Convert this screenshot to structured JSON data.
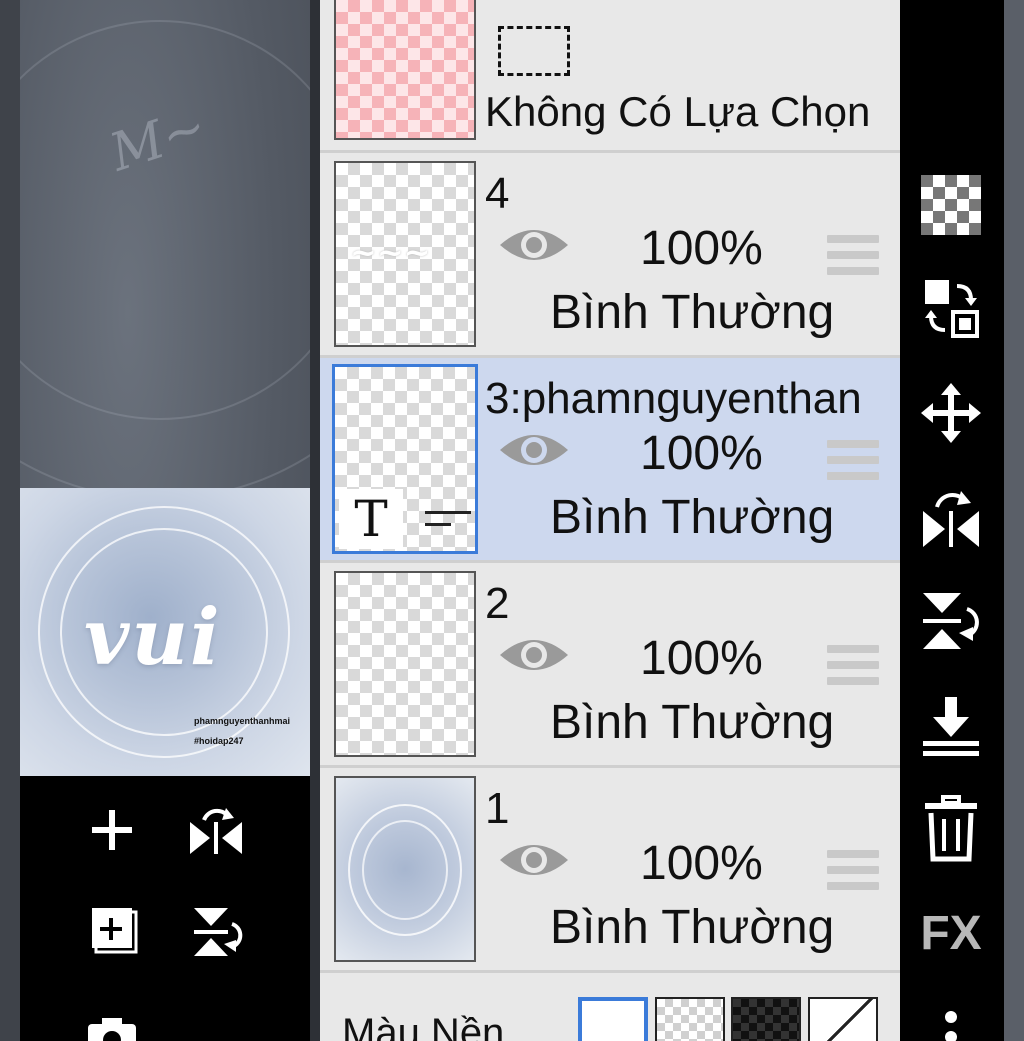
{
  "selection_layer": {
    "label": "Không Có Lựa Chọn"
  },
  "layers": [
    {
      "name": "4",
      "opacity": "100%",
      "blend": "Bình Thường",
      "selected": false
    },
    {
      "name": "3:phamnguyenthan",
      "opacity": "100%",
      "blend": "Bình Thường",
      "selected": true
    },
    {
      "name": "2",
      "opacity": "100%",
      "blend": "Bình Thường",
      "selected": false
    },
    {
      "name": "1",
      "opacity": "100%",
      "blend": "Bình Thường",
      "selected": false
    }
  ],
  "background": {
    "label": "Màu Nền"
  },
  "preview": {
    "word": "vui",
    "credit_name": "phamnguyenthanhmai",
    "credit_tag": "#hoidap247"
  },
  "text_layer_badge": "T",
  "right_toolbar": {
    "fx_label": "FX",
    "icons": [
      "transparency-icon",
      "swap-layers-icon",
      "move-icon",
      "flip-horizontal-icon",
      "flip-vertical-icon",
      "merge-down-icon",
      "trash-icon",
      "fx-icon",
      "more-icon"
    ]
  },
  "colors": {
    "selected_row": "#cdd8ee",
    "selected_border": "#3b7bd9",
    "panel_bg": "#e8e8e8",
    "toolbar_bg": "#000000"
  }
}
